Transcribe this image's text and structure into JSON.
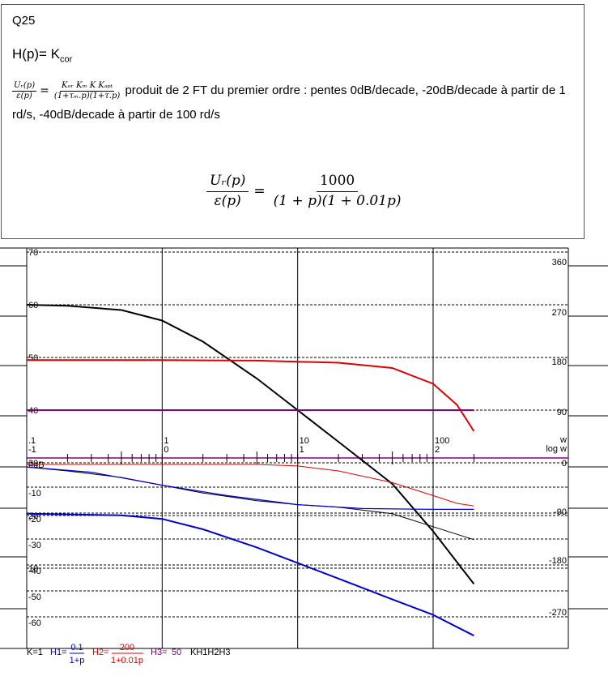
{
  "question": {
    "label": "Q25",
    "h_lhs": "H(p)= K",
    "h_sub": "cor",
    "eq1_lhs_num": "Uᵣ(p)",
    "eq1_lhs_den": "ε(p)",
    "eq1_rhs_num": "Kₒᵣ Kₘ K Kₐₚₜ",
    "eq1_rhs_den": "(1+τₘ.p)(1+τ.p)",
    "eq1_text": "produit de 2 FT du premier ordre : pentes 0dB/decade, -20dB/decade à partir de 1 rd/s, -40dB/decade à partir de 100 rd/s",
    "eq2_lhs_num": "Uᵣ(p)",
    "eq2_lhs_den": "ε(p)",
    "eq2_rhs_num": "1000",
    "eq2_rhs_den": "(1 + p)(1 + 0.01p)"
  },
  "chart_data": {
    "type": "line",
    "title": "",
    "xlabel": "w",
    "xlabel2": "log w",
    "x_scale": "log",
    "xlim": [
      0.1,
      200
    ],
    "x_ticks": [
      {
        "value": 0.1,
        "label": ".1",
        "log_label": "-1"
      },
      {
        "value": 1,
        "label": "1",
        "log_label": "0"
      },
      {
        "value": 10,
        "label": "10",
        "log_label": "1"
      },
      {
        "value": 100,
        "label": "100",
        "log_label": "2"
      }
    ],
    "upper_left_ticks": [
      "70",
      "60",
      "50",
      "40",
      "30",
      "20",
      "10"
    ],
    "upper_right_ticks": [
      "360",
      "270",
      "180",
      "90",
      "0"
    ],
    "lower_left_ticks": [
      "0dB",
      "-10",
      "-20",
      "-30",
      "-40",
      "-50",
      "-60"
    ],
    "lower_right_ticks": [
      "-90",
      "-180",
      "-270"
    ],
    "grid": true,
    "upper_series": [
      {
        "color": "#000000",
        "x": [
          0.1,
          0.2,
          0.5,
          1,
          2,
          5,
          10,
          20,
          50,
          100,
          200
        ],
        "y": [
          60,
          59.8,
          59,
          57,
          53,
          46,
          40,
          34,
          26,
          17,
          7
        ]
      },
      {
        "color": "#e00000",
        "x": [
          0.1,
          1,
          5,
          10,
          20,
          50,
          100,
          150,
          200
        ],
        "y": [
          49.5,
          49.5,
          49.4,
          49.2,
          49,
          48,
          45,
          41,
          36
        ]
      },
      {
        "color": "#800080",
        "x": [
          0.1,
          200
        ],
        "y": [
          40,
          40
        ]
      }
    ],
    "lower_series": [
      {
        "color": "#000000",
        "x": [
          0.1,
          0.2,
          0.5,
          1,
          2,
          5,
          10,
          20,
          50,
          100,
          200
        ],
        "y": [
          -1,
          -2.5,
          -5,
          -8,
          -11,
          -14,
          -15.5,
          -16.5,
          -19,
          -24,
          -29
        ]
      },
      {
        "color": "#0000cc",
        "x": [
          0.1,
          0.3,
          1,
          3,
          10,
          30,
          100,
          200
        ],
        "y": [
          -1,
          -3,
          -8,
          -12,
          -15.5,
          -17,
          -17.3,
          -17.3
        ]
      },
      {
        "color": "#e00000",
        "x": [
          0.1,
          5,
          10,
          20,
          50,
          100,
          150,
          200
        ],
        "y": [
          0,
          0,
          -0.6,
          -2.5,
          -7,
          -12,
          -15,
          -16
        ]
      },
      {
        "color": "#0000cc",
        "x": [
          0.1,
          0.5,
          1,
          2,
          5,
          10,
          20,
          50,
          100,
          200
        ],
        "y": [
          -19,
          -19.6,
          -21,
          -25,
          -32,
          -38,
          -44,
          -52,
          -58,
          -66
        ]
      }
    ]
  },
  "legend": {
    "k": "K=1",
    "h1_label": "H1=",
    "h1_num": "0.1",
    "h1_den": "1+p",
    "h2_label": "H2=",
    "h2_num": "200",
    "h2_den": "1+0.01p",
    "h3_label": "H3=",
    "h3_value": "50",
    "product": "KH1H2H3",
    "colors": {
      "h1": "#0000cc",
      "h2": "#e00000",
      "h3": "#800080"
    }
  }
}
